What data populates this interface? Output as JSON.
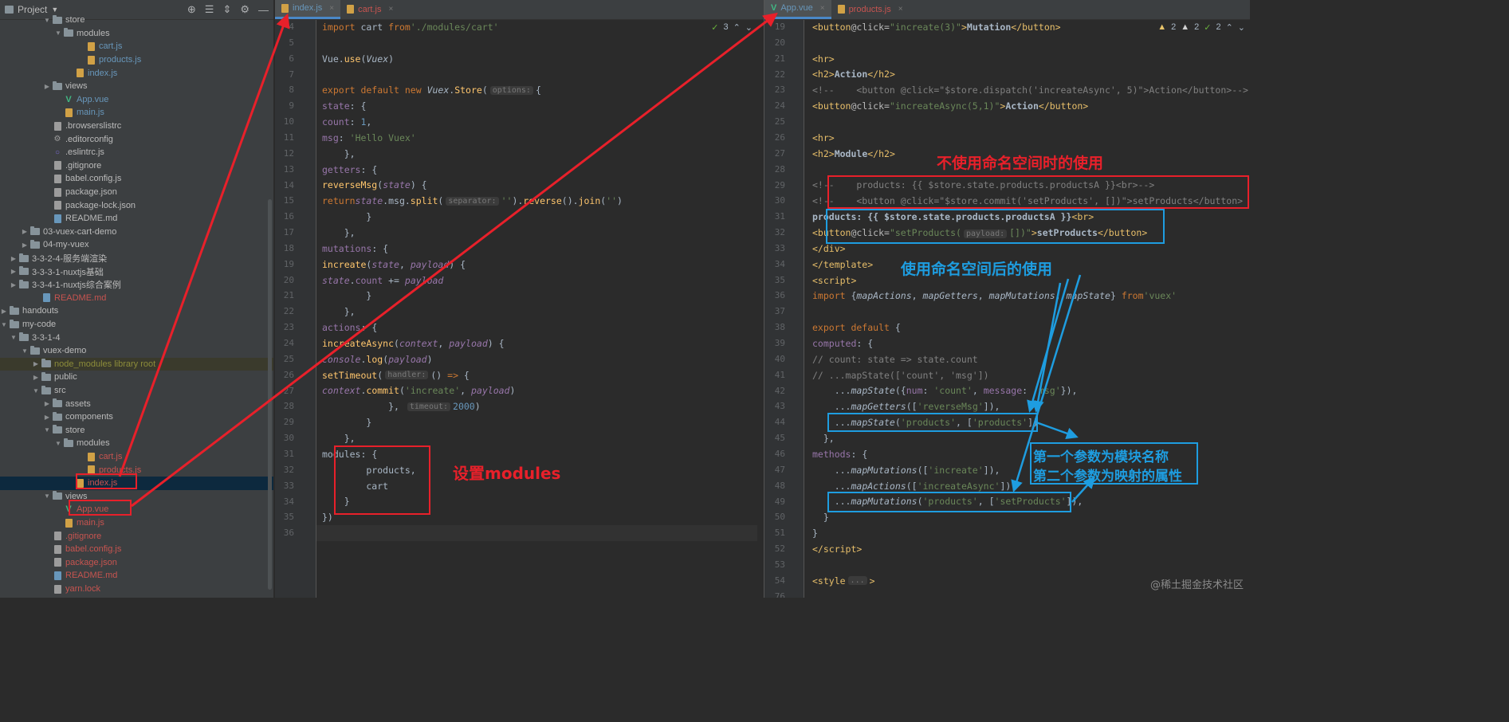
{
  "sidebar": {
    "title": "Project",
    "tree": [
      {
        "label": "store",
        "depth": 6,
        "type": "folder",
        "open": true
      },
      {
        "label": "modules",
        "depth": 7,
        "type": "folder",
        "open": true
      },
      {
        "label": "cart.js",
        "depth": 9,
        "type": "js",
        "cls": "c-mod"
      },
      {
        "label": "products.js",
        "depth": 9,
        "type": "js",
        "cls": "c-mod"
      },
      {
        "label": "index.js",
        "depth": 8,
        "type": "js",
        "cls": "c-mod"
      },
      {
        "label": "views",
        "depth": 6,
        "type": "folder",
        "open": false
      },
      {
        "label": "App.vue",
        "depth": 7,
        "type": "vue",
        "cls": "c-mod"
      },
      {
        "label": "main.js",
        "depth": 7,
        "type": "js",
        "cls": "c-mod"
      },
      {
        "label": ".browserslistrc",
        "depth": 6,
        "type": "json"
      },
      {
        "label": ".editorconfig",
        "depth": 6,
        "type": "gear"
      },
      {
        "label": ".eslintrc.js",
        "depth": 6,
        "type": "circ"
      },
      {
        "label": ".gitignore",
        "depth": 6,
        "type": "json"
      },
      {
        "label": "babel.config.js",
        "depth": 6,
        "type": "json"
      },
      {
        "label": "package.json",
        "depth": 6,
        "type": "json"
      },
      {
        "label": "package-lock.json",
        "depth": 6,
        "type": "json"
      },
      {
        "label": "README.md",
        "depth": 6,
        "type": "md"
      },
      {
        "label": "03-vuex-cart-demo",
        "depth": 4,
        "type": "folder",
        "open": false
      },
      {
        "label": "04-my-vuex",
        "depth": 4,
        "type": "folder",
        "open": false
      },
      {
        "label": "3-3-2-4-服务端渲染",
        "depth": 3,
        "type": "folder",
        "open": false
      },
      {
        "label": "3-3-3-1-nuxtjs基础",
        "depth": 3,
        "type": "folder",
        "open": false
      },
      {
        "label": "3-3-4-1-nuxtjs综合案例",
        "depth": 3,
        "type": "folder",
        "open": false
      },
      {
        "label": "README.md",
        "depth": 5,
        "type": "md",
        "cls": "c-untracked"
      },
      {
        "label": "handouts",
        "depth": 2,
        "type": "folder",
        "open": false
      },
      {
        "label": "my-code",
        "depth": 2,
        "type": "folder",
        "open": true
      },
      {
        "label": "3-3-1-4",
        "depth": 3,
        "type": "folder",
        "open": true
      },
      {
        "label": "vuex-demo",
        "depth": 4,
        "type": "folder",
        "open": true
      },
      {
        "label": "node_modules library root",
        "depth": 5,
        "type": "folder",
        "open": false,
        "cls": "c-lib",
        "lib": true
      },
      {
        "label": "public",
        "depth": 5,
        "type": "folder",
        "open": false
      },
      {
        "label": "src",
        "depth": 5,
        "type": "folder",
        "open": true
      },
      {
        "label": "assets",
        "depth": 6,
        "type": "folder",
        "open": false
      },
      {
        "label": "components",
        "depth": 6,
        "type": "folder",
        "open": false
      },
      {
        "label": "store",
        "depth": 6,
        "type": "folder",
        "open": true
      },
      {
        "label": "modules",
        "depth": 7,
        "type": "folder",
        "open": true
      },
      {
        "label": "cart.js",
        "depth": 9,
        "type": "js",
        "cls": "c-untracked"
      },
      {
        "label": "products.js",
        "depth": 9,
        "type": "js",
        "cls": "c-untracked"
      },
      {
        "label": "index.js",
        "depth": 8,
        "type": "js",
        "cls": "c-untracked",
        "sel": true
      },
      {
        "label": "views",
        "depth": 6,
        "type": "folder",
        "open": true
      },
      {
        "label": "App.vue",
        "depth": 7,
        "type": "vue",
        "cls": "c-untracked"
      },
      {
        "label": "main.js",
        "depth": 7,
        "type": "js",
        "cls": "c-untracked"
      },
      {
        "label": ".gitignore",
        "depth": 6,
        "type": "json",
        "cls": "c-untracked"
      },
      {
        "label": "babel.config.js",
        "depth": 6,
        "type": "json",
        "cls": "c-untracked"
      },
      {
        "label": "package.json",
        "depth": 6,
        "type": "json",
        "cls": "c-untracked"
      },
      {
        "label": "README.md",
        "depth": 6,
        "type": "md",
        "cls": "c-untracked"
      },
      {
        "label": "yarn.lock",
        "depth": 6,
        "type": "json",
        "cls": "c-untracked"
      }
    ]
  },
  "left_editor": {
    "tabs": [
      {
        "label": "index.js",
        "active": true
      },
      {
        "label": "cart.js",
        "active": false
      }
    ],
    "inspection": "3",
    "lines": [
      {
        "n": 4,
        "html": "<span class='kw'>import</span> cart <span class='kw'>from</span> <span class='str'>'./modules/cart'</span>"
      },
      {
        "n": 5,
        "html": ""
      },
      {
        "n": 6,
        "html": "Vue.<span class='fn'>use</span>(<span class='ital'>Vuex</span>)"
      },
      {
        "n": 7,
        "html": ""
      },
      {
        "n": 8,
        "html": "<span class='kw'>export default new </span><span class='ital'>Vuex</span>.<span class='fn'>Store</span>(<span class='hint'>options:</span>{"
      },
      {
        "n": 9,
        "html": "    <span class='prop'>state</span>: {"
      },
      {
        "n": 10,
        "html": "        <span class='prop'>count</span>: <span class='num'>1</span>,"
      },
      {
        "n": 11,
        "html": "        <span class='prop'>msg</span>: <span class='str'>'Hello Vuex'</span>"
      },
      {
        "n": 12,
        "html": "    },"
      },
      {
        "n": 13,
        "html": "    <span class='prop'>getters</span>: {"
      },
      {
        "n": 14,
        "html": "        <span class='fn'>reverseMsg</span>(<span class='prop ital'>state</span>) {"
      },
      {
        "n": 15,
        "html": "            <span class='kw'>return</span> <span class='prop ital'>state</span>.msg.<span class='fn'>split</span>(<span class='hint'>separator:</span><span class='str'>''</span>).<span class='fn'>reverse</span>().<span class='fn'>join</span>(<span class='str'>''</span>)"
      },
      {
        "n": 16,
        "html": "        }"
      },
      {
        "n": 17,
        "html": "    },"
      },
      {
        "n": 18,
        "html": "    <span class='prop'>mutations</span>: {"
      },
      {
        "n": 19,
        "html": "        <span class='fn'>increate</span>(<span class='prop ital'>state</span>, <span class='prop ital'>payload</span>) {"
      },
      {
        "n": 20,
        "html": "            <span class='prop ital'>state</span>.<span class='prop'>count</span> += <span class='prop ital'>payload</span>"
      },
      {
        "n": 21,
        "html": "        }"
      },
      {
        "n": 22,
        "html": "    },"
      },
      {
        "n": 23,
        "html": "    <span class='prop'>actions</span>: {"
      },
      {
        "n": 24,
        "html": "        <span class='fn'>increateAsync</span>(<span class='prop ital'>context</span>, <span class='prop ital'>payload</span>) {"
      },
      {
        "n": 25,
        "html": "            <span class='prop ital'>console</span>.<span class='fn'>log</span>(<span class='prop ital'>payload</span>)"
      },
      {
        "n": 26,
        "html": "            <span class='fn'>setTimeout</span>(<span class='hint'>handler:</span>() <span class='kw'>=></span> {"
      },
      {
        "n": 27,
        "html": "                <span class='prop ital'>context</span>.<span class='fn'>commit</span>(<span class='str'>'increate'</span>, <span class='prop ital'>payload</span>)"
      },
      {
        "n": 28,
        "html": "            }, <span class='hint'>timeout:</span><span class='num'>2000</span>)"
      },
      {
        "n": 29,
        "html": "        }"
      },
      {
        "n": 30,
        "html": "    },"
      },
      {
        "n": 31,
        "html": "    <span class='par'>modules</span>: {"
      },
      {
        "n": 32,
        "html": "        products,"
      },
      {
        "n": 33,
        "html": "        cart"
      },
      {
        "n": 34,
        "html": "    }"
      },
      {
        "n": 35,
        "html": "})"
      },
      {
        "n": 36,
        "html": ""
      }
    ]
  },
  "right_editor": {
    "tabs": [
      {
        "label": "App.vue",
        "active": true
      },
      {
        "label": "products.js",
        "active": false
      }
    ],
    "inspection": {
      "warn1": "2",
      "warn2": "2",
      "ok": "2"
    },
    "lines": [
      {
        "n": 19,
        "html": "    <span class='tag'>&lt;button</span> <span class='attr'>@click=</span><span class='str'>\"increate(3)\"</span><span class='tag'>&gt;</span><b>Mutation</b><span class='tag'>&lt;/button&gt;</span>"
      },
      {
        "n": 20,
        "html": ""
      },
      {
        "n": 21,
        "html": "    <span class='tag'>&lt;hr&gt;</span>"
      },
      {
        "n": 22,
        "html": "    <span class='tag'>&lt;h2&gt;</span><b>Action</b><span class='tag'>&lt;/h2&gt;</span>"
      },
      {
        "n": 23,
        "html": "    <span class='cmt'>&lt;!--    &lt;button @click=\"$store.dispatch('increateAsync', 5)\"&gt;Action&lt;/button&gt;--&gt;</span>"
      },
      {
        "n": 24,
        "html": "    <span class='tag'>&lt;button</span> <span class='attr'>@click=</span><span class='str'>\"increateAsync(5,1)\"</span><span class='tag'>&gt;</span><b>Action</b><span class='tag'>&lt;/button&gt;</span>"
      },
      {
        "n": 25,
        "html": ""
      },
      {
        "n": 26,
        "html": "    <span class='tag'>&lt;hr&gt;</span>"
      },
      {
        "n": 27,
        "html": "    <span class='tag'>&lt;h2&gt;</span><b>Module</b><span class='tag'>&lt;/h2&gt;</span>"
      },
      {
        "n": 28,
        "html": ""
      },
      {
        "n": 29,
        "html": "    <span class='cmt'>&lt;!--    products: {{ $store.state.products.productsA }}&lt;br&gt;--&gt;</span>"
      },
      {
        "n": 30,
        "html": "    <span class='cmt'>&lt;!--    &lt;button @click=\"$store.commit('setProducts', [])\"&gt;setProducts&lt;/button&gt;</span>"
      },
      {
        "n": 31,
        "html": "    <b>products: {{ $store.state.products.productsA }}</b><span class='tag'>&lt;br&gt;</span>"
      },
      {
        "n": 32,
        "html": "    <span class='tag'>&lt;button</span> <span class='attr'>@click=</span><span class='str'>\"setProducts(<span class='hint'>payload:</span>[])\"</span><span class='tag'>&gt;</span><b>setProducts</b><span class='tag'>&lt;/button&gt;</span>"
      },
      {
        "n": 33,
        "html": "  <span class='tag'>&lt;/div&gt;</span>"
      },
      {
        "n": 34,
        "html": "<span class='tag'>&lt;/template&gt;</span>"
      },
      {
        "n": 35,
        "html": "<span class='tag'>&lt;script&gt;</span>"
      },
      {
        "n": 36,
        "html": "<span class='kw'>import</span> {<span class='ital'>mapActions</span>, <span class='ital'>mapGetters</span>, <span class='ital'>mapMutations</span>, <span class='ital'>mapState</span>} <span class='kw'>from</span> <span class='str'>'vuex'</span>"
      },
      {
        "n": 37,
        "html": ""
      },
      {
        "n": 38,
        "html": "<span class='kw'>export default</span> {"
      },
      {
        "n": 39,
        "html": "  <span class='prop'>computed</span>: {"
      },
      {
        "n": 40,
        "html": "    <span class='cmt'>// count: state => state.count</span>"
      },
      {
        "n": 41,
        "html": "    <span class='cmt'>// ...mapState(['count', 'msg'])</span>"
      },
      {
        "n": 42,
        "html": "    ...<span class='ital'>mapState</span>({<span class='prop'>num</span>: <span class='str'>'count'</span>, <span class='prop'>message</span>: <span class='str'>'msg'</span>}),"
      },
      {
        "n": 43,
        "html": "    ...<span class='ital'>mapGetters</span>([<span class='str'>'reverseMsg'</span>]),"
      },
      {
        "n": 44,
        "html": "    ...<span class='ital'>mapState</span>(<span class='str'>'products'</span>, [<span class='str'>'products'</span>])"
      },
      {
        "n": 45,
        "html": "  },"
      },
      {
        "n": 46,
        "html": "  <span class='prop'>methods</span>: {"
      },
      {
        "n": 47,
        "html": "    ...<span class='ital'>mapMutations</span>([<span class='str'>'increate'</span>]),"
      },
      {
        "n": 48,
        "html": "    ...<span class='ital'>mapActions</span>([<span class='str'>'increateAsync'</span>]),"
      },
      {
        "n": 49,
        "html": "    ...<span class='ital'>mapMutations</span>(<span class='str'>'products'</span>, [<span class='str'>'setProducts'</span>]),"
      },
      {
        "n": 50,
        "html": "  }"
      },
      {
        "n": 51,
        "html": "}"
      },
      {
        "n": 52,
        "html": "<span class='tag'>&lt;/script&gt;</span>"
      },
      {
        "n": 53,
        "html": ""
      },
      {
        "n": 54,
        "html": "<span class='tag'>&lt;style</span><span class='hint'>...</span><span class='tag'>&gt;</span>"
      },
      {
        "n": 76,
        "html": ""
      }
    ]
  },
  "annotations": {
    "set_modules": "设置modules",
    "no_namespace": "不使用命名空间时的使用",
    "with_namespace": "使用命名空间后的使用",
    "param_note_1": "第一个参数为模块名称",
    "param_note_2": "第二个参数为映射的属性"
  },
  "colors": {
    "red": "#e8202a",
    "blue": "#1e9de0"
  },
  "watermark": "@稀土掘金技术社区"
}
